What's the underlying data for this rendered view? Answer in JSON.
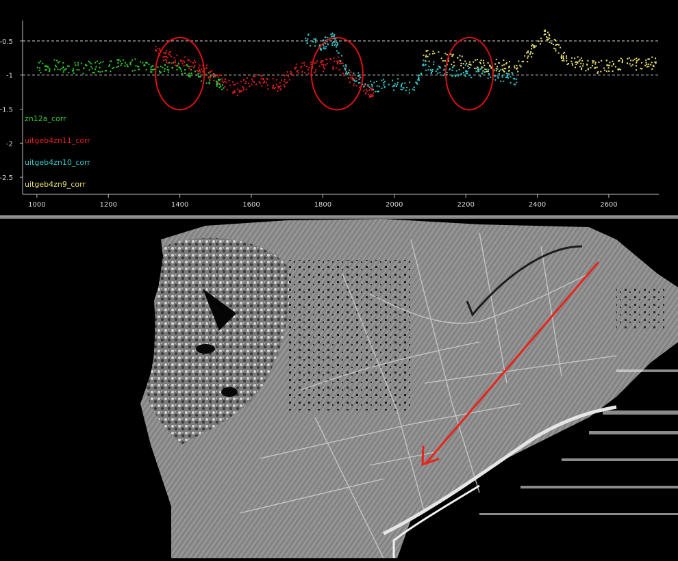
{
  "chart_data": {
    "type": "scatter",
    "xlim": [
      960,
      2740
    ],
    "ylim": [
      -2.75,
      -0.25
    ],
    "x_ticks": [
      1000,
      1200,
      1400,
      1600,
      1800,
      2000,
      2200,
      2400,
      2600
    ],
    "y_ticks": [
      -0.5,
      -1,
      -1.5,
      -2,
      -2.5
    ],
    "x_tick_labels": [
      "1000",
      "1200",
      "1400",
      "1600",
      "1800",
      "2000",
      "2200",
      "2400",
      "2600"
    ],
    "y_tick_labels": [
      "-0.5",
      "-1",
      "-1.5",
      "-2",
      "-2.5"
    ],
    "reference_lines": [
      -0.5,
      -1
    ],
    "legend_position": "left",
    "series": [
      {
        "name": "zn12a_corr",
        "color": "#33cc33",
        "points": [
          [
            1000,
            -0.88
          ],
          [
            1050,
            -0.85
          ],
          [
            1100,
            -0.9
          ],
          [
            1150,
            -0.87
          ],
          [
            1200,
            -0.86
          ],
          [
            1250,
            -0.84
          ],
          [
            1300,
            -0.85
          ],
          [
            1350,
            -0.88
          ],
          [
            1400,
            -0.9
          ],
          [
            1450,
            -0.97
          ],
          [
            1500,
            -1.08
          ],
          [
            1520,
            -1.18
          ]
        ]
      },
      {
        "name": "uitgeb4zn11_corr",
        "color": "#e02020",
        "points": [
          [
            1330,
            -0.62
          ],
          [
            1360,
            -0.72
          ],
          [
            1400,
            -0.78
          ],
          [
            1440,
            -0.85
          ],
          [
            1480,
            -0.95
          ],
          [
            1520,
            -1.1
          ],
          [
            1560,
            -1.2
          ],
          [
            1600,
            -1.05
          ],
          [
            1640,
            -1.1
          ],
          [
            1680,
            -1.15
          ],
          [
            1720,
            -0.9
          ],
          [
            1760,
            -0.88
          ],
          [
            1800,
            -0.85
          ],
          [
            1840,
            -0.8
          ],
          [
            1880,
            -1.05
          ],
          [
            1920,
            -1.2
          ],
          [
            1940,
            -1.25
          ]
        ]
      },
      {
        "name": "uitgeb4zn10_corr",
        "color": "#33c8c8",
        "points": [
          [
            1750,
            -0.45
          ],
          [
            1790,
            -0.55
          ],
          [
            1810,
            -0.5
          ],
          [
            1830,
            -0.45
          ],
          [
            1860,
            -0.9
          ],
          [
            1900,
            -1.05
          ],
          [
            1950,
            -1.15
          ],
          [
            2000,
            -1.12
          ],
          [
            2050,
            -1.2
          ],
          [
            2080,
            -0.85
          ],
          [
            2120,
            -0.9
          ],
          [
            2160,
            -0.92
          ],
          [
            2200,
            -0.93
          ],
          [
            2250,
            -0.95
          ],
          [
            2300,
            -1.0
          ],
          [
            2340,
            -1.05
          ]
        ]
      },
      {
        "name": "uitgeb4zn9_corr",
        "color": "#e8e070",
        "points": [
          [
            2080,
            -0.7
          ],
          [
            2150,
            -0.75
          ],
          [
            2200,
            -0.82
          ],
          [
            2250,
            -0.85
          ],
          [
            2300,
            -0.85
          ],
          [
            2340,
            -0.9
          ],
          [
            2380,
            -0.65
          ],
          [
            2420,
            -0.35
          ],
          [
            2450,
            -0.55
          ],
          [
            2480,
            -0.78
          ],
          [
            2520,
            -0.82
          ],
          [
            2560,
            -0.88
          ],
          [
            2600,
            -0.85
          ],
          [
            2650,
            -0.82
          ],
          [
            2700,
            -0.85
          ],
          [
            2730,
            -0.8
          ]
        ]
      }
    ],
    "annotations": [
      {
        "type": "circle",
        "color": "#dd1111",
        "center": [
          1400,
          -0.98
        ],
        "rx": 68,
        "ry": 0.53
      },
      {
        "type": "circle",
        "color": "#dd1111",
        "center": [
          1840,
          -0.98
        ],
        "rx": 72,
        "ry": 0.53
      },
      {
        "type": "circle",
        "color": "#dd1111",
        "center": [
          2210,
          -0.98
        ],
        "rx": 66,
        "ry": 0.53
      }
    ]
  },
  "map": {
    "type": "shaded-relief elevation map",
    "arrow_color": "#e8241a",
    "arrow_direction": "northeast-to-southwest"
  }
}
